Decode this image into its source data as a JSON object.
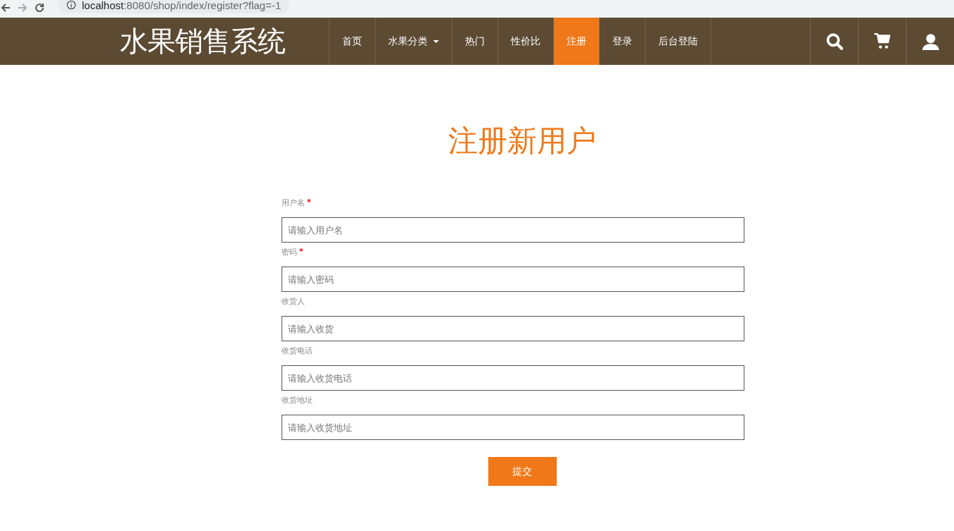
{
  "browser": {
    "url_host": "localhost",
    "url_rest": ":8080/shop/index/register?flag=-1"
  },
  "header": {
    "brand": "水果销售系统",
    "nav": [
      {
        "label": "首页",
        "kind": "link",
        "selected": false
      },
      {
        "label": "水果分类",
        "kind": "dropdown",
        "selected": false
      },
      {
        "label": "热门",
        "kind": "link",
        "selected": false
      },
      {
        "label": "性价比",
        "kind": "link",
        "selected": false
      },
      {
        "label": "注册",
        "kind": "link",
        "selected": true
      },
      {
        "label": "登录",
        "kind": "link",
        "selected": false
      },
      {
        "label": "后台登陆",
        "kind": "link",
        "selected": false
      }
    ]
  },
  "form": {
    "title": "注册新用户",
    "fields": [
      {
        "label": "用户名",
        "required_mark": "*",
        "placeholder": "请输入用户名"
      },
      {
        "label": "密码",
        "required_mark": "*",
        "placeholder": "请输入密码"
      },
      {
        "label": "收货人",
        "placeholder": "请输入收货"
      },
      {
        "label": "收货电话",
        "placeholder": "请输入收货电话"
      },
      {
        "label": "收货地址",
        "placeholder": "请输入收货地址"
      }
    ],
    "submit": "提交"
  }
}
